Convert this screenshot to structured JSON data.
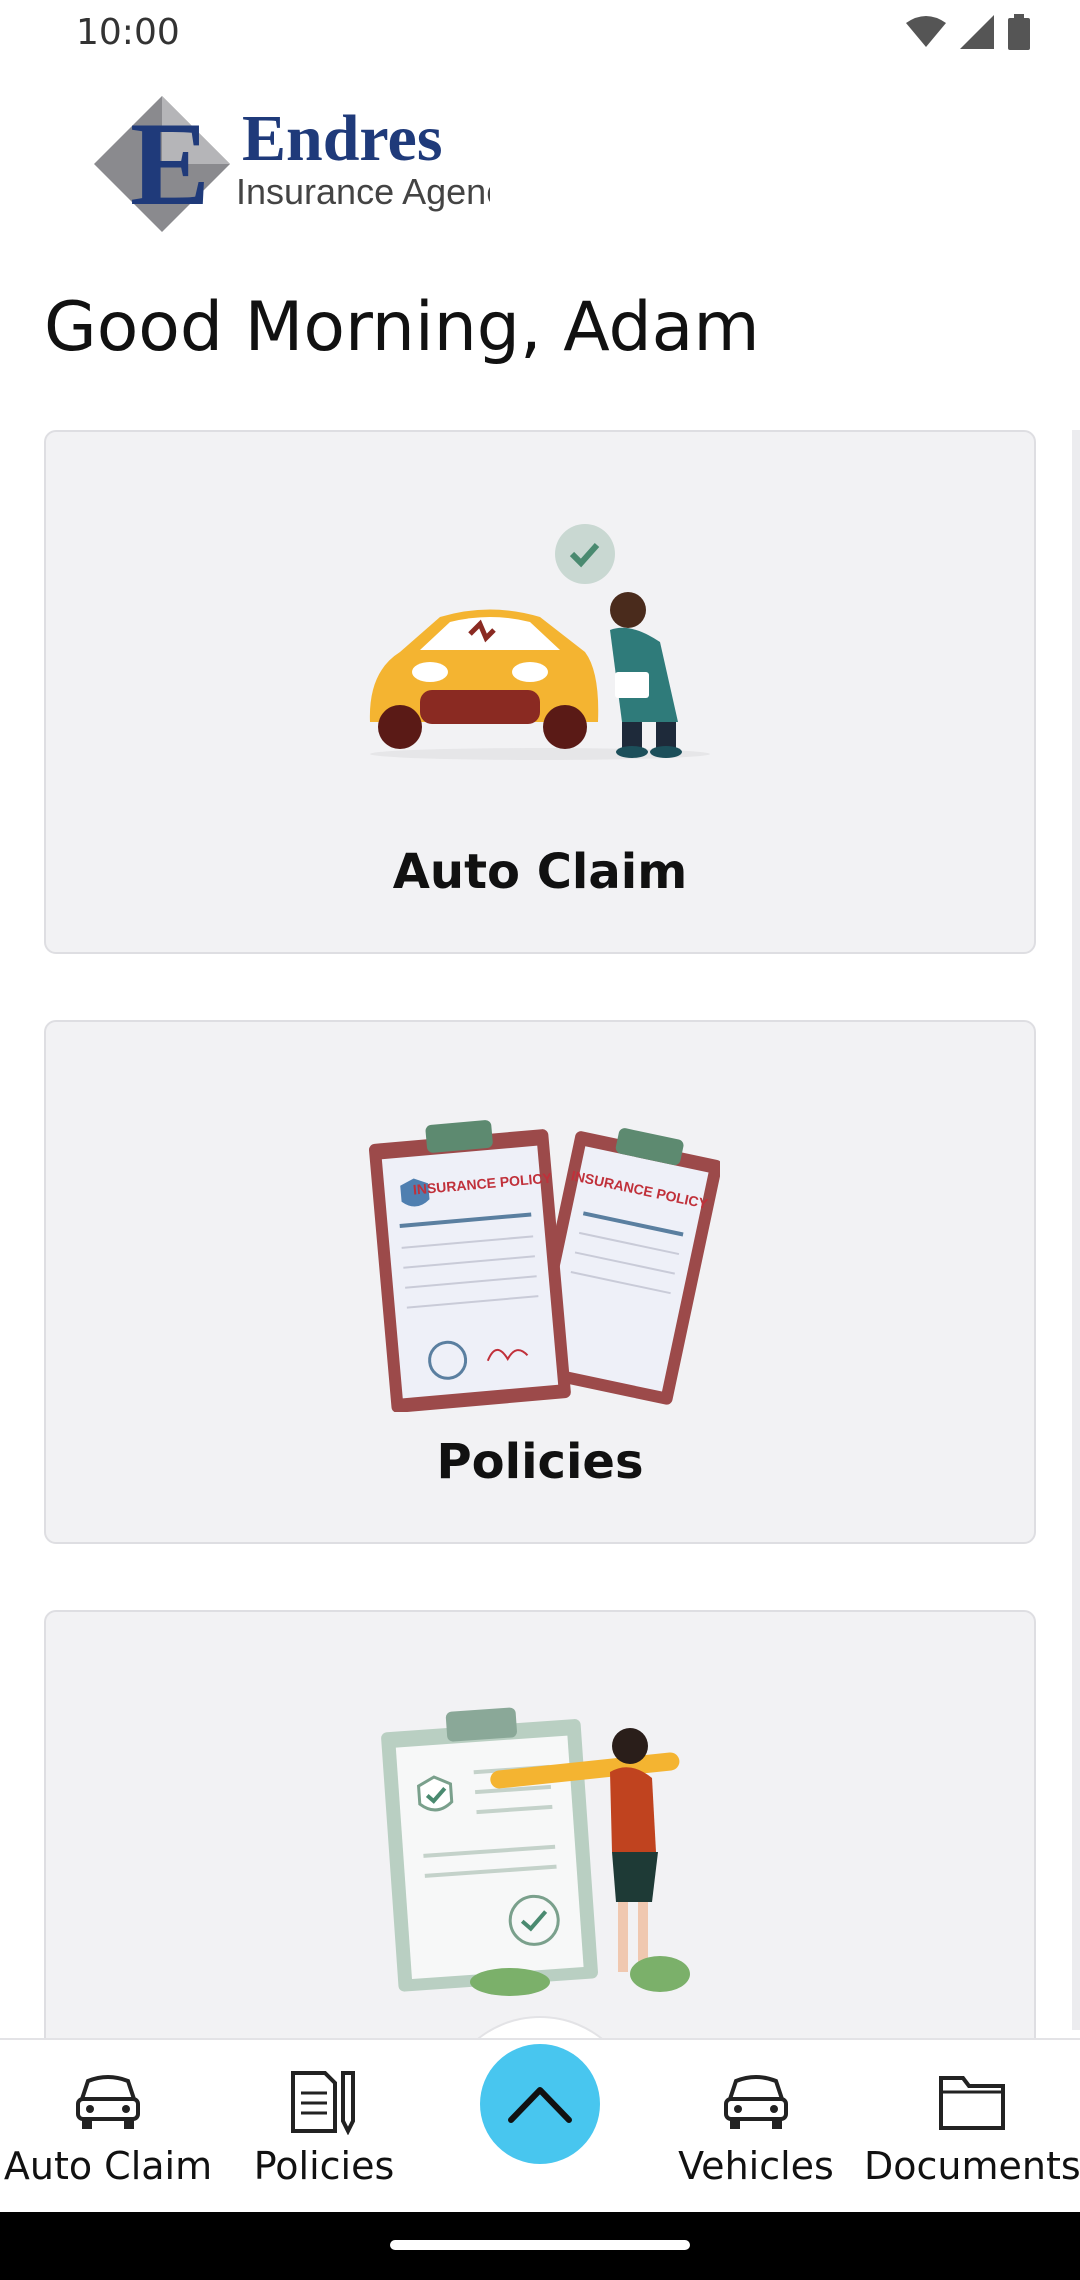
{
  "status_bar": {
    "time": "10:00"
  },
  "logo": {
    "name": "Endres",
    "tagline": "Insurance Agency, Inc"
  },
  "greeting": "Good Morning, Adam",
  "cards": [
    {
      "label": "Auto Claim",
      "illustration": "auto-claim-illustration"
    },
    {
      "label": "Policies",
      "illustration": "insurance-policy-illustration",
      "document_text": "INSURANCE POLICY"
    },
    {
      "label": "",
      "illustration": "checklist-illustration"
    }
  ],
  "bottom_nav": {
    "items": [
      {
        "label": "Auto Claim",
        "icon": "car-icon"
      },
      {
        "label": "Policies",
        "icon": "document-pen-icon"
      },
      {
        "label": "Vehicles",
        "icon": "car-icon"
      },
      {
        "label": "Documents",
        "icon": "folder-icon"
      }
    ],
    "fab_icon": "chevron-up-icon"
  },
  "colors": {
    "accent": "#48c6ef",
    "card_bg": "#f2f2f4",
    "logo_navy": "#1f3a7a"
  }
}
